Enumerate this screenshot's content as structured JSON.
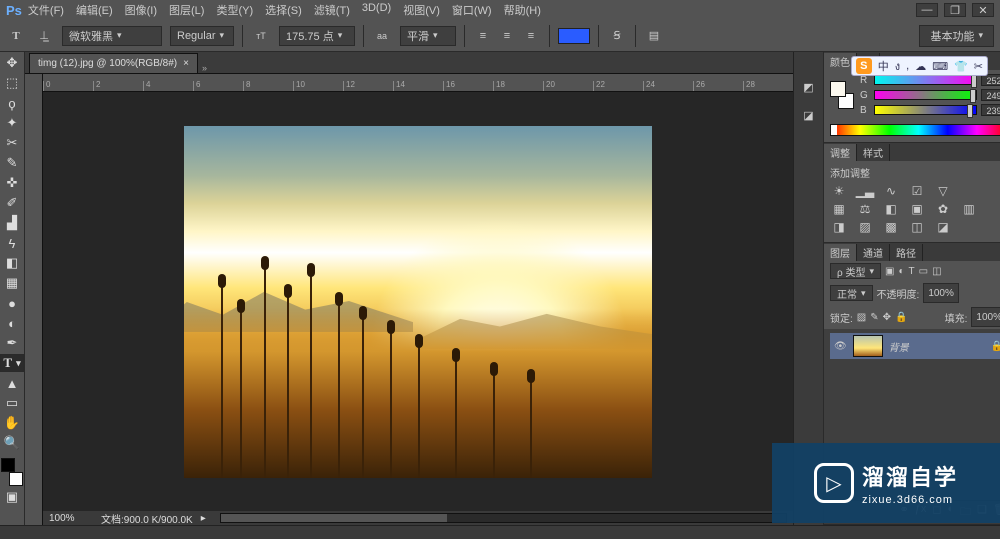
{
  "titlebar": {
    "app": "Ps",
    "menus": [
      "文件(F)",
      "编辑(E)",
      "图像(I)",
      "图层(L)",
      "类型(Y)",
      "选择(S)",
      "滤镜(T)",
      "3D(D)",
      "视图(V)",
      "窗口(W)",
      "帮助(H)"
    ]
  },
  "options": {
    "tool_icon": "T",
    "font_family": "微软雅黑",
    "font_style": "Regular",
    "font_size": "175.75 点",
    "aa_label": "aa",
    "anti_alias": "平滑",
    "text_color": "#2a5cff",
    "workspace": "基本功能"
  },
  "doc": {
    "tab": "timg (12).jpg @ 100%(RGB/8#)",
    "close": "×",
    "ruler_marks": [
      "0",
      "2",
      "4",
      "6",
      "8",
      "10",
      "12",
      "14",
      "16",
      "18",
      "20",
      "22",
      "24",
      "26",
      "28"
    ]
  },
  "footer": {
    "zoom": "100%",
    "docinfo": "文档:900.0 K/900.0K"
  },
  "panels": {
    "color": {
      "tab": "颜色",
      "tab2": "色",
      "R": 252,
      "G": 249,
      "B": 239
    },
    "adjustments": {
      "tab": "调整",
      "tab2": "样式",
      "title": "添加调整"
    },
    "layers": {
      "tabs": [
        "图层",
        "通道",
        "路径"
      ],
      "kind": "ρ 类型",
      "blend": "正常",
      "opacity_label": "不透明度:",
      "opacity": "100%",
      "lock_label": "锁定:",
      "fill_label": "填充:",
      "fill": "100%",
      "layer_name": "背景"
    }
  },
  "ime": [
    "中",
    "ง",
    ",",
    "☁",
    "⌨",
    "👕",
    "✂"
  ],
  "watermark": {
    "big": "溜溜自学",
    "sub": "zixue.3d66.com"
  }
}
